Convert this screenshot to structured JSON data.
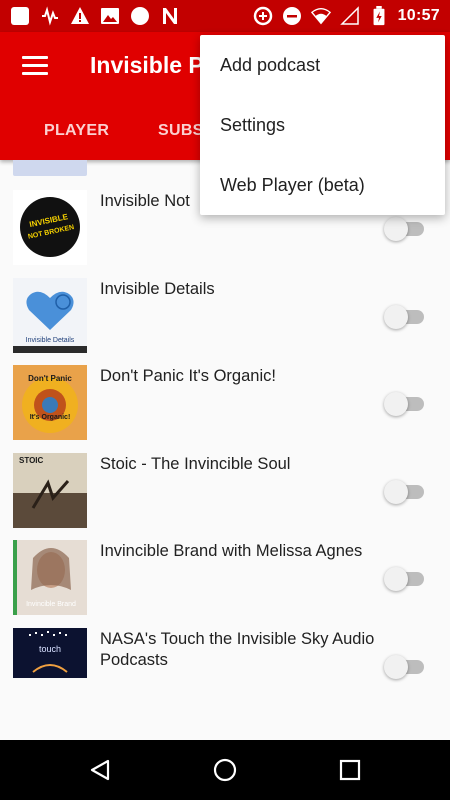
{
  "status_bar": {
    "time": "10:57",
    "left_icons": [
      "app-square-icon",
      "audio-wave-icon",
      "warning-icon",
      "image-icon",
      "circle-icon",
      "n-app-icon"
    ],
    "right_icons": [
      "data-saver-icon",
      "do-not-disturb-icon",
      "wifi-icon",
      "no-signal-icon",
      "battery-charging-icon"
    ]
  },
  "app_bar": {
    "title": "Invisible P",
    "tabs": [
      "PLAYER",
      "SUBS"
    ]
  },
  "menu": {
    "items": [
      "Add podcast",
      "Settings",
      "Web Player (beta)"
    ]
  },
  "podcasts": [
    {
      "title": "Invisible Not",
      "thumb_text": "INVISIBLE NOT BROKEN",
      "subscribed": false
    },
    {
      "title": "Invisible Details",
      "thumb_text": "Invisible Details",
      "subscribed": false
    },
    {
      "title": "Don't Panic It's Organic!",
      "thumb_text": "Don't Panic It's Organic!",
      "subscribed": false
    },
    {
      "title": "Stoic - The  Invincible Soul",
      "thumb_text": "STOIC",
      "subscribed": false
    },
    {
      "title": "Invincible Brand with Melissa Agnes",
      "thumb_text": "Invincible Brand",
      "subscribed": false
    },
    {
      "title": "NASA's Touch the Invisible Sky Audio Podcasts",
      "thumb_text": "touch",
      "subscribed": false
    }
  ],
  "colors": {
    "status_bar": "#c20000",
    "app_bar": "#e00000",
    "toggle_off_track": "#bdbdbd",
    "toggle_off_knob": "#f1f1f1"
  }
}
